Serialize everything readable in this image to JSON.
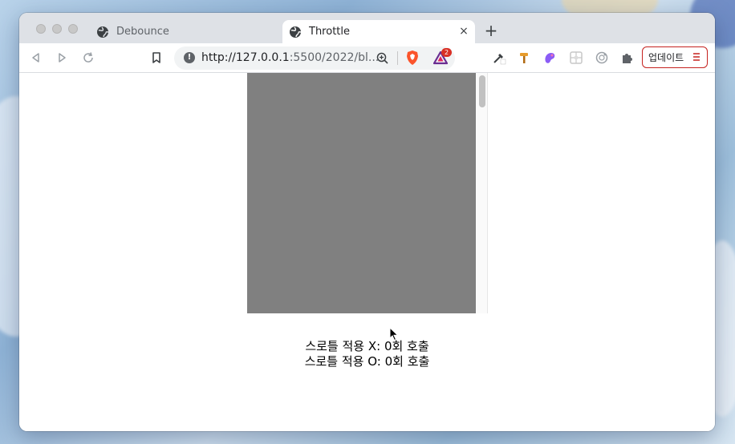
{
  "browser": {
    "tabs": [
      {
        "title": "Debounce",
        "active": false
      },
      {
        "title": "Throttle",
        "active": true
      }
    ],
    "new_tab_symbol": "+",
    "close_symbol": "×",
    "address": {
      "host": "http://127.0.0.1",
      "path": ":5500/2022/bl..."
    },
    "extensions": [
      {
        "icon": "brave-shield-icon"
      },
      {
        "icon": "brave-rewards-icon",
        "badge": "2"
      },
      {
        "icon": "eyedropper-icon"
      },
      {
        "icon": "hammer-icon"
      },
      {
        "icon": "palette-icon"
      },
      {
        "icon": "grid-icon"
      },
      {
        "icon": "circle-icon"
      },
      {
        "icon": "puzzle-icon"
      }
    ],
    "update_label": "업데이트",
    "accent_color": "#c5221f"
  },
  "page": {
    "box_color": "#808080",
    "results": [
      "스로틀 적용 X: 0회 호출",
      "스로틀 적용 O: 0회 호출"
    ]
  }
}
